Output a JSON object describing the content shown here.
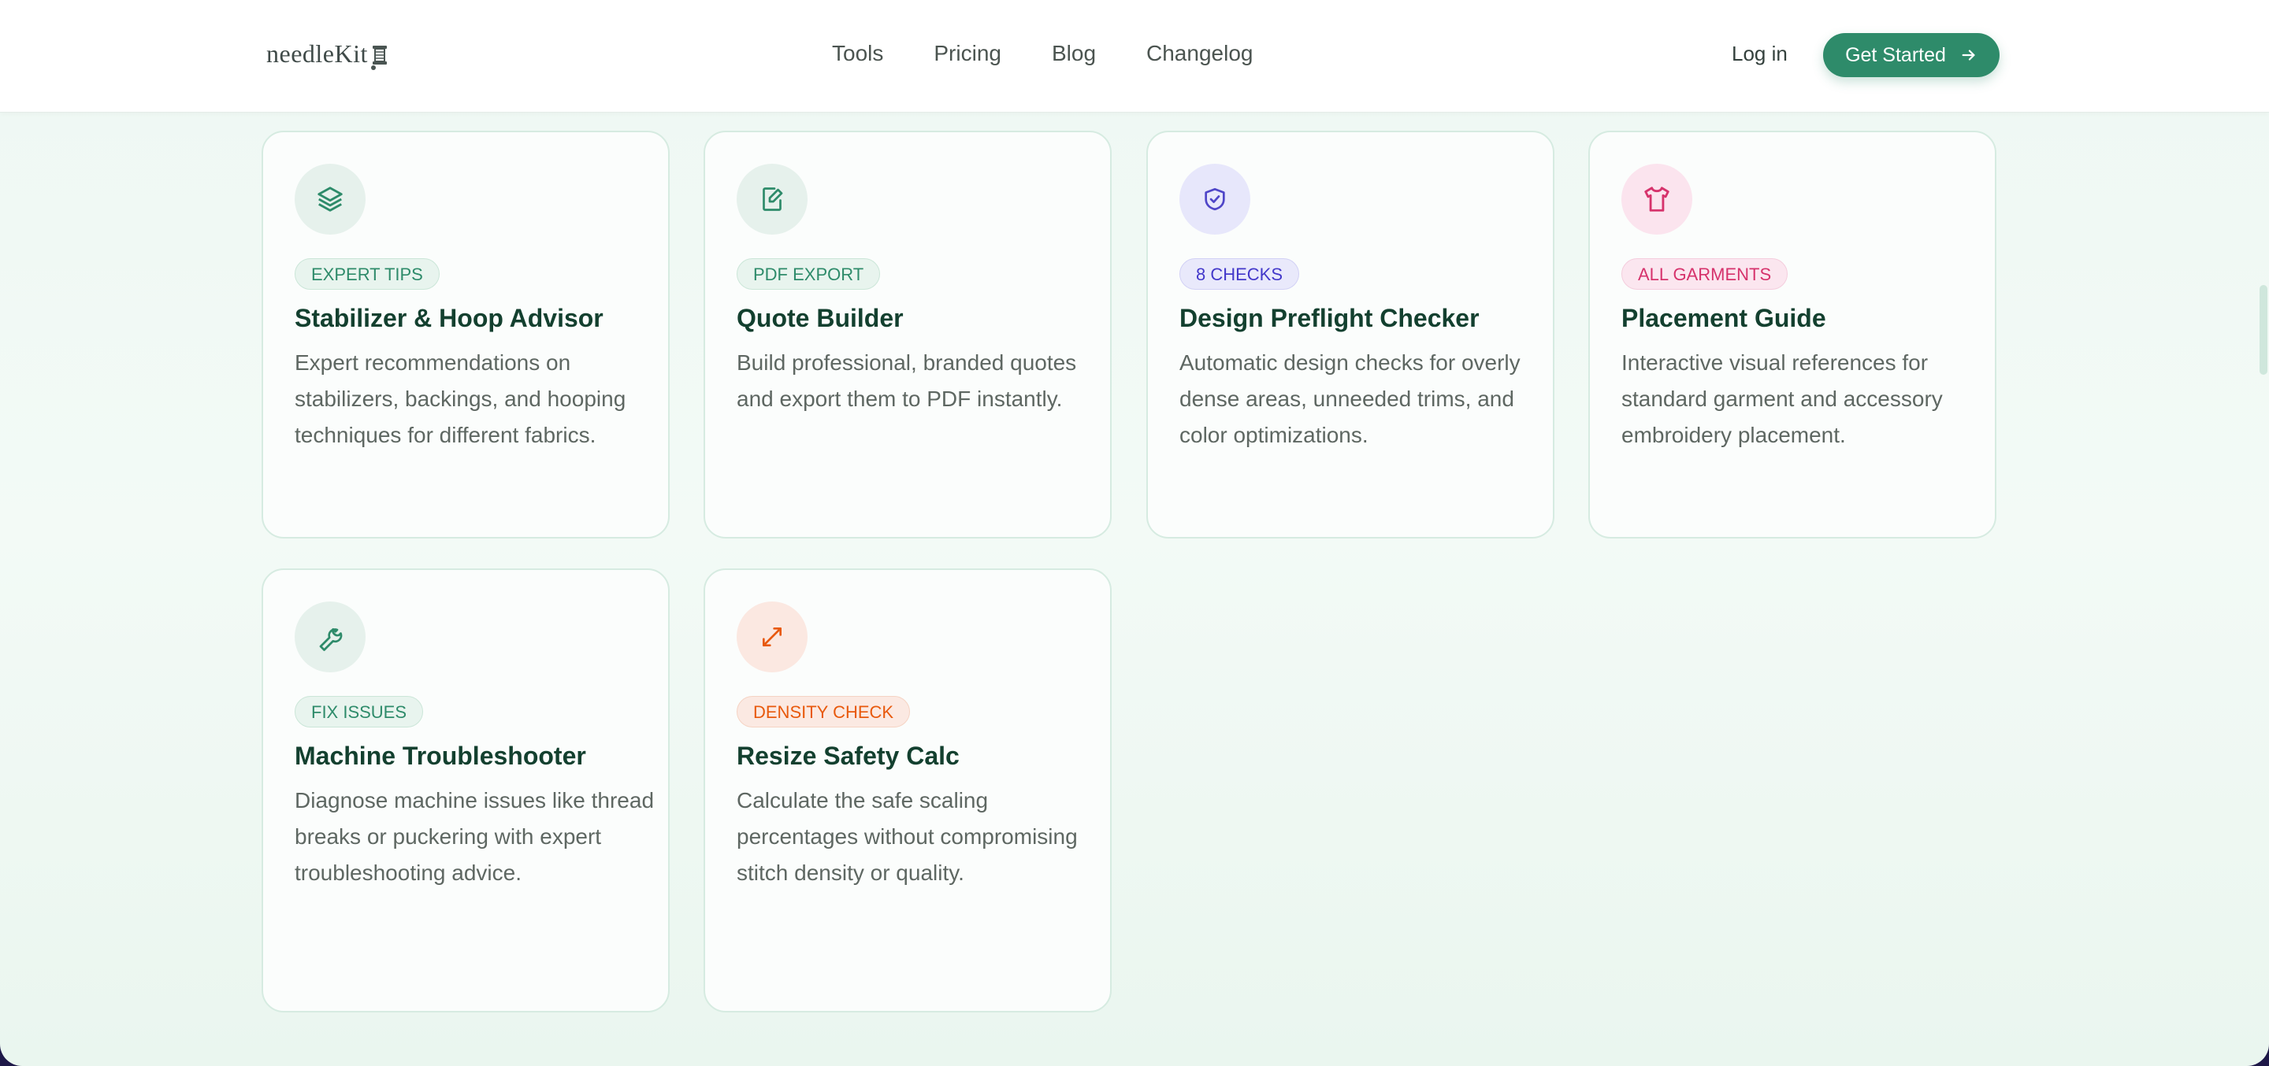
{
  "header": {
    "logo_text": "needleKit",
    "nav": [
      "Tools",
      "Pricing",
      "Blog",
      "Changelog"
    ],
    "login_label": "Log in",
    "cta_label": "Get Started"
  },
  "cards": [
    {
      "icon": "layers-icon",
      "badge": "EXPERT TIPS",
      "title": "Stabilizer & Hoop Advisor",
      "description": "Expert recommendations on stabilizers, backings, and hooping techniques for different fabrics."
    },
    {
      "icon": "file-edit-icon",
      "badge": "PDF EXPORT",
      "title": "Quote Builder",
      "description": "Build professional, branded quotes and export them to PDF instantly."
    },
    {
      "icon": "shield-check-icon",
      "badge": "8 CHECKS",
      "title": "Design Preflight Checker",
      "description": "Automatic design checks for overly dense areas, unneeded trims, and color optimizations."
    },
    {
      "icon": "shirt-icon",
      "badge": "ALL GARMENTS",
      "title": "Placement Guide",
      "description": "Interactive visual references for standard garment and accessory embroidery placement."
    },
    {
      "icon": "wrench-icon",
      "badge": "FIX ISSUES",
      "title": "Machine Troubleshooter",
      "description": "Diagnose machine issues like thread breaks or puckering with expert troubleshooting advice."
    },
    {
      "icon": "resize-arrows-icon",
      "badge": "DENSITY CHECK",
      "title": "Resize Safety Calc",
      "description": "Calculate the safe scaling percentages without compromising stitch density or quality."
    }
  ],
  "colors": {
    "brand_green": "#2e8b6a",
    "title_green": "#13402f",
    "badge_green_bg": "#e8f4ee",
    "badge_indigo_bg": "#e9e9fb",
    "badge_pink_bg": "#fbe6ef",
    "badge_orange_bg": "#fbe9e2"
  }
}
